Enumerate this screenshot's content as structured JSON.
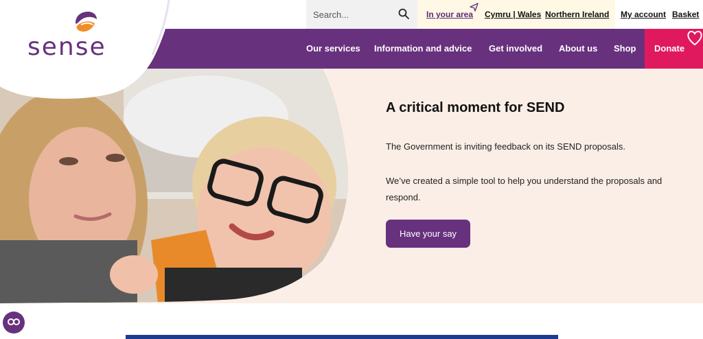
{
  "brand": {
    "logo_text": "sense",
    "purple": "#67317e",
    "pink": "#e0195f",
    "orange": "#f28c28"
  },
  "utility": {
    "search_placeholder": "Search...",
    "links": [
      {
        "label": "In your area",
        "icon": "paper-plane-icon"
      },
      {
        "label": "Cymru | Wales"
      },
      {
        "label": "Northern Ireland"
      },
      {
        "label": "My account"
      },
      {
        "label": "Basket"
      }
    ]
  },
  "nav": {
    "items": [
      {
        "label": "Our services"
      },
      {
        "label": "Information and advice"
      },
      {
        "label": "Get involved"
      },
      {
        "label": "About us"
      },
      {
        "label": "Shop"
      }
    ],
    "donate_label": "Donate"
  },
  "hero": {
    "title": "A critical moment for SEND",
    "paragraph1": "The Government is inviting feedback on its SEND proposals.",
    "paragraph2": "We’ve created a simple tool to help you understand the proposals and respond.",
    "cta_label": "Have your say",
    "background": "#fbeee6"
  },
  "accessibility": {
    "icon": "accessibility-link-icon"
  }
}
